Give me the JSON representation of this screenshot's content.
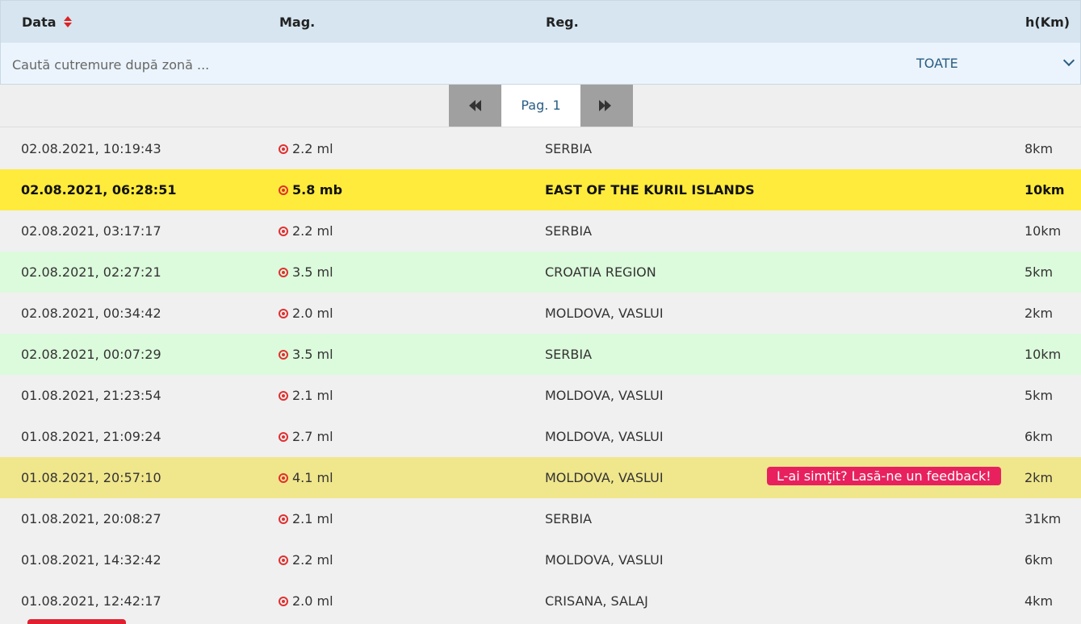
{
  "header": {
    "col_date": "Data",
    "col_mag": "Mag.",
    "col_region": "Reg.",
    "col_depth": "h(Km)"
  },
  "search": {
    "placeholder": "Caută cutremure după zonă ...",
    "filter_value": "TOATE"
  },
  "pager": {
    "page_label": "Pag. 1"
  },
  "colors": {
    "header_bg": "#d6e5f0",
    "highlight_yellow": "#ffeb3b",
    "highlight_green": "#dcfadc",
    "highlight_khaki": "#f0e68c",
    "feedback_pink": "#e8215e",
    "quake_red": "#e03030"
  },
  "feedback_label": "L-ai simţit? Lasă-ne un feedback!",
  "rows": [
    {
      "date": "02.08.2021, 10:19:43",
      "mag": "2.2 ml",
      "region": "SERBIA",
      "depth": "8km",
      "style": "normal"
    },
    {
      "date": "02.08.2021, 06:28:51",
      "mag": "5.8 mb",
      "region": "EAST OF THE KURIL ISLANDS",
      "depth": "10km",
      "style": "yellow"
    },
    {
      "date": "02.08.2021, 03:17:17",
      "mag": "2.2 ml",
      "region": "SERBIA",
      "depth": "10km",
      "style": "normal"
    },
    {
      "date": "02.08.2021, 02:27:21",
      "mag": "3.5 ml",
      "region": "CROATIA REGION",
      "depth": "5km",
      "style": "green"
    },
    {
      "date": "02.08.2021, 00:34:42",
      "mag": "2.0 ml",
      "region": "MOLDOVA, VASLUI",
      "depth": "2km",
      "style": "normal"
    },
    {
      "date": "02.08.2021, 00:07:29",
      "mag": "3.5 ml",
      "region": "SERBIA",
      "depth": "10km",
      "style": "green"
    },
    {
      "date": "01.08.2021, 21:23:54",
      "mag": "2.1 ml",
      "region": "MOLDOVA, VASLUI",
      "depth": "5km",
      "style": "normal"
    },
    {
      "date": "01.08.2021, 21:09:24",
      "mag": "2.7 ml",
      "region": "MOLDOVA, VASLUI",
      "depth": "6km",
      "style": "normal"
    },
    {
      "date": "01.08.2021, 20:57:10",
      "mag": "4.1 ml",
      "region": "MOLDOVA, VASLUI",
      "depth": "2km",
      "style": "khaki",
      "feedback": true
    },
    {
      "date": "01.08.2021, 20:08:27",
      "mag": "2.1 ml",
      "region": "SERBIA",
      "depth": "31km",
      "style": "normal"
    },
    {
      "date": "01.08.2021, 14:32:42",
      "mag": "2.2 ml",
      "region": "MOLDOVA, VASLUI",
      "depth": "6km",
      "style": "normal"
    },
    {
      "date": "01.08.2021, 12:42:17",
      "mag": "2.0 ml",
      "region": "CRISANA, SALAJ",
      "depth": "4km",
      "style": "normal"
    }
  ]
}
